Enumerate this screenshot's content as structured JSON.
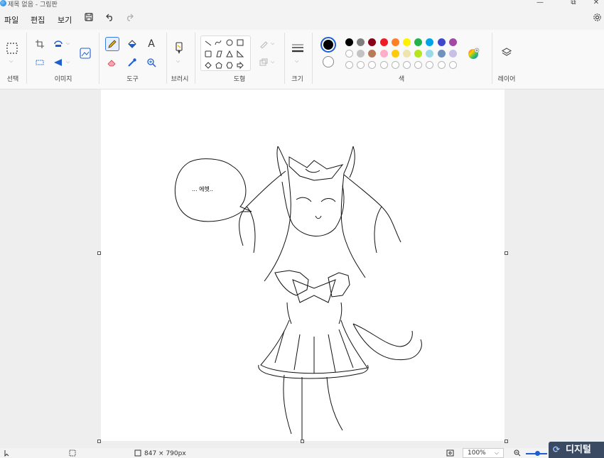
{
  "window": {
    "title": "제목 없음 - 그림판",
    "minimize_glyph": "—",
    "restore_glyph": "⧉",
    "close_glyph": "✕"
  },
  "menu": {
    "file": "파일",
    "edit": "편집",
    "view": "보기"
  },
  "ribbon": {
    "groups": {
      "select": "선택",
      "image": "이미지",
      "tools": "도구",
      "brushes": "브러시",
      "shapes": "도형",
      "size": "크기",
      "colors": "색",
      "layers": "레이어"
    },
    "text_tool_glyph": "A",
    "primary_color": "#000000",
    "secondary_color": "#ffffff",
    "palette": {
      "row1": [
        "#000000",
        "#7f7f7f",
        "#880015",
        "#ed1c24",
        "#ff7f27",
        "#fff200",
        "#22b14c",
        "#00a2e8",
        "#3f48cc",
        "#a349a4"
      ],
      "row2": [
        "#ffffff",
        "#c3c3c3",
        "#b97a57",
        "#ffaec9",
        "#ffc90e",
        "#efe4b0",
        "#b5e61d",
        "#99d9ea",
        "#7092be",
        "#c8bfe7"
      ]
    }
  },
  "canvas": {
    "speech_text": "... 에헷.."
  },
  "status": {
    "dimensions": "847 × 790px",
    "zoom": "100%",
    "zoom_caret": "⌵"
  },
  "watermark": {
    "text": "디지털"
  }
}
